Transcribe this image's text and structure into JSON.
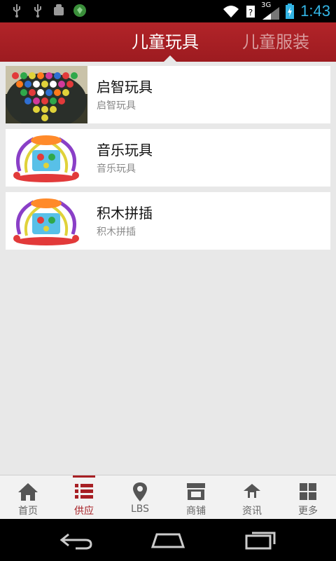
{
  "status_bar": {
    "network": "3G",
    "time": "1:43"
  },
  "tabs": [
    {
      "label": "儿童玩具",
      "active": true
    },
    {
      "label": "儿童服装",
      "active": false
    }
  ],
  "items": [
    {
      "title": "启智玩具",
      "subtitle": "启智玩具",
      "image": "bead-toy-image"
    },
    {
      "title": "音乐玩具",
      "subtitle": "音乐玩具",
      "image": "activity-cube-image"
    },
    {
      "title": "积木拼插",
      "subtitle": "积木拼插",
      "image": "activity-cube-image"
    }
  ],
  "bottom_nav": [
    {
      "label": "首页",
      "icon": "home-icon"
    },
    {
      "label": "供应",
      "icon": "list-icon",
      "active": true
    },
    {
      "label": "LBS",
      "icon": "location-pin-icon"
    },
    {
      "label": "商铺",
      "icon": "store-icon"
    },
    {
      "label": "资讯",
      "icon": "news-icon"
    },
    {
      "label": "更多",
      "icon": "grid-icon"
    }
  ],
  "colors": {
    "header": "#a71f24",
    "status_accent": "#33b5e5",
    "background": "#e8e8e8"
  }
}
